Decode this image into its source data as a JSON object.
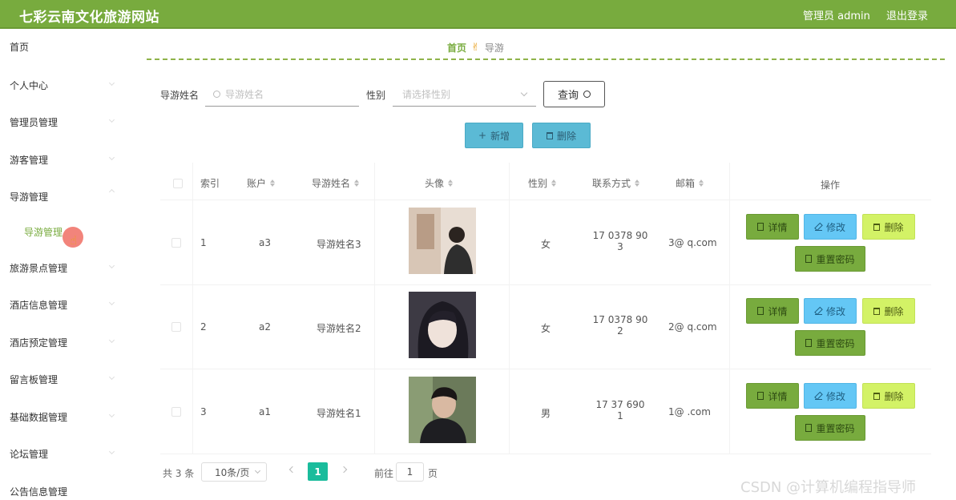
{
  "header": {
    "site_title": "七彩云南文化旅游网站",
    "user_label": "管理员 admin",
    "logout_label": "退出登录",
    "brand_color": "#78ab3e"
  },
  "sidebar": {
    "items": [
      {
        "label": "首页"
      },
      {
        "label": "个人中心"
      },
      {
        "label": "管理员管理"
      },
      {
        "label": "游客管理"
      },
      {
        "label": "导游管理"
      },
      {
        "label": "旅游景点管理"
      },
      {
        "label": "酒店信息管理"
      },
      {
        "label": "酒店预定管理"
      },
      {
        "label": "留言板管理"
      },
      {
        "label": "基础数据管理"
      },
      {
        "label": "论坛管理"
      },
      {
        "label": "公告信息管理"
      }
    ],
    "active_sub": "导游管理"
  },
  "breadcrumb": {
    "home": "首页",
    "current": "导游"
  },
  "search": {
    "name_label": "导游姓名",
    "name_placeholder": "导游姓名",
    "gender_label": "性别",
    "gender_placeholder": "请选择性别",
    "query_label": "查询"
  },
  "actions": {
    "add_label": "新增",
    "delete_label": "删除"
  },
  "table": {
    "columns": [
      "索引",
      "账户",
      "导游姓名",
      "头像",
      "性别",
      "联系方式",
      "邮箱",
      "操作"
    ],
    "rows": [
      {
        "index": "1",
        "account": "a3",
        "name": "导游姓名3",
        "gender": "女",
        "phone": "17 0378 90",
        "phone2": "3",
        "email": "3@ q.com"
      },
      {
        "index": "2",
        "account": "a2",
        "name": "导游姓名2",
        "gender": "女",
        "phone": "17 0378 90",
        "phone2": "2",
        "email": "2@ q.com"
      },
      {
        "index": "3",
        "account": "a1",
        "name": "导游姓名1",
        "gender": "男",
        "phone": "17 37 690",
        "phone2": "1",
        "email": "1@ .com"
      }
    ],
    "row_buttons": {
      "detail": "详情",
      "edit": "修改",
      "delete": "删除",
      "reset": "重置密码"
    }
  },
  "pagination": {
    "total": "共 3 条",
    "page_size": "10条/页",
    "current_page": "1",
    "goto_label": "前往",
    "goto_value": "1",
    "page_unit": "页"
  },
  "watermark": "CSDN @计算机编程指导师"
}
